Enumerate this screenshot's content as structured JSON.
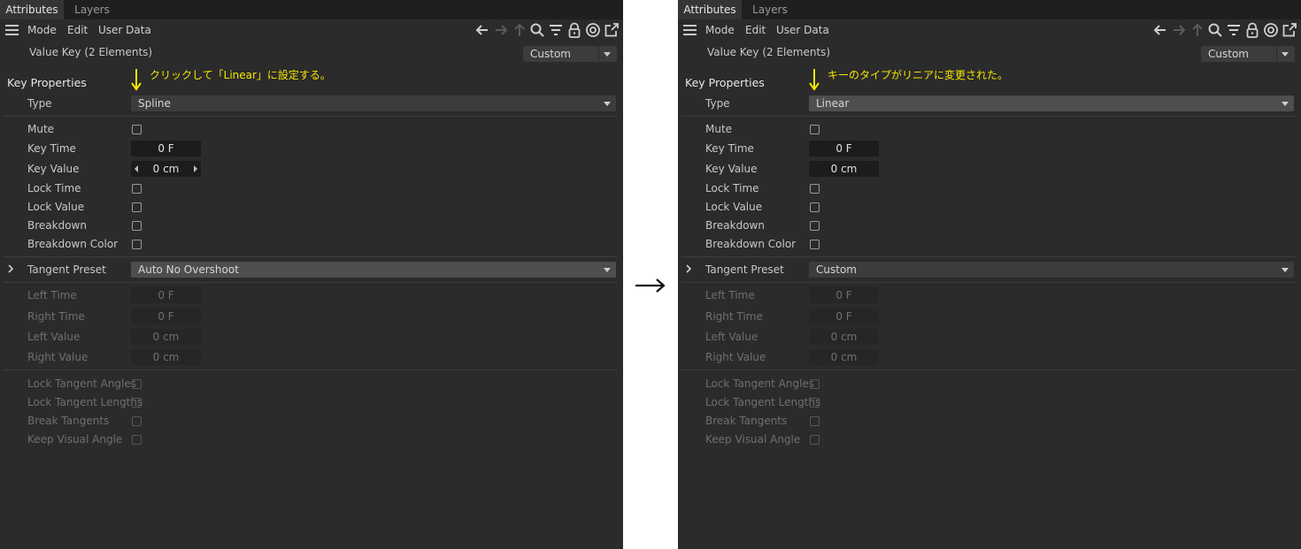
{
  "arrow_between": "→",
  "panels": [
    {
      "tabs": {
        "attributes": "Attributes",
        "layers": "Layers"
      },
      "menu": {
        "mode": "Mode",
        "edit": "Edit",
        "user_data": "User Data"
      },
      "toolbar_icons": [
        "back-arrow-icon",
        "forward-arrow-icon",
        "up-arrow-icon",
        "search-icon",
        "filter-icon",
        "lock-icon",
        "target-icon",
        "new-window-icon"
      ],
      "header": {
        "label": "Value Key (2 Elements)",
        "mode_select": "Custom"
      },
      "group_title": "Key Properties",
      "annotation": "クリックして「Linear」に設定する。",
      "type": {
        "label": "Type",
        "value": "Spline"
      },
      "mute": {
        "label": "Mute"
      },
      "key_time": {
        "label": "Key Time",
        "value": "0 F"
      },
      "key_value": {
        "label": "Key Value",
        "value": "0 cm"
      },
      "lock_time": {
        "label": "Lock Time"
      },
      "lock_value": {
        "label": "Lock Value"
      },
      "breakdown": {
        "label": "Breakdown"
      },
      "breakdown_color": {
        "label": "Breakdown Color"
      },
      "tangent_preset": {
        "label": "Tangent Preset",
        "value": "Auto No Overshoot"
      },
      "left_time": {
        "label": "Left  Time",
        "value": "0 F"
      },
      "right_time": {
        "label": "Right Time",
        "value": "0 F"
      },
      "left_value": {
        "label": "Left  Value",
        "value": "0 cm"
      },
      "right_value": {
        "label": "Right Value",
        "value": "0 cm"
      },
      "lock_tangent_angles": {
        "label": "Lock Tangent Angles"
      },
      "lock_tangent_lengths": {
        "label": "Lock Tangent Lengths"
      },
      "break_tangents": {
        "label": "Break Tangents"
      },
      "keep_visual_angle": {
        "label": "Keep Visual Angle"
      }
    },
    {
      "tabs": {
        "attributes": "Attributes",
        "layers": "Layers"
      },
      "menu": {
        "mode": "Mode",
        "edit": "Edit",
        "user_data": "User Data"
      },
      "toolbar_icons": [
        "back-arrow-icon",
        "forward-arrow-icon",
        "up-arrow-icon",
        "search-icon",
        "filter-icon",
        "lock-icon",
        "target-icon",
        "new-window-icon"
      ],
      "header": {
        "label": "Value Key (2 Elements)",
        "mode_select": "Custom"
      },
      "group_title": "Key Properties",
      "annotation": "キーのタイプがリニアに変更された。",
      "type": {
        "label": "Type",
        "value": "Linear"
      },
      "mute": {
        "label": "Mute"
      },
      "key_time": {
        "label": "Key Time",
        "value": "0 F"
      },
      "key_value": {
        "label": "Key Value",
        "value": "0 cm"
      },
      "lock_time": {
        "label": "Lock Time"
      },
      "lock_value": {
        "label": "Lock Value"
      },
      "breakdown": {
        "label": "Breakdown"
      },
      "breakdown_color": {
        "label": "Breakdown Color"
      },
      "tangent_preset": {
        "label": "Tangent Preset",
        "value": "Custom"
      },
      "left_time": {
        "label": "Left  Time",
        "value": "0 F"
      },
      "right_time": {
        "label": "Right Time",
        "value": "0 F"
      },
      "left_value": {
        "label": "Left  Value",
        "value": "0 cm"
      },
      "right_value": {
        "label": "Right Value",
        "value": "0 cm"
      },
      "lock_tangent_angles": {
        "label": "Lock Tangent Angles"
      },
      "lock_tangent_lengths": {
        "label": "Lock Tangent Lengths"
      },
      "break_tangents": {
        "label": "Break Tangents"
      },
      "keep_visual_angle": {
        "label": "Keep Visual Angle"
      }
    }
  ],
  "colors": {
    "panel_bg": "#2b2b2b",
    "annotation": "#f5e600",
    "field_bg": "#1c1c1c",
    "select_bg": "#3c3c3c"
  }
}
